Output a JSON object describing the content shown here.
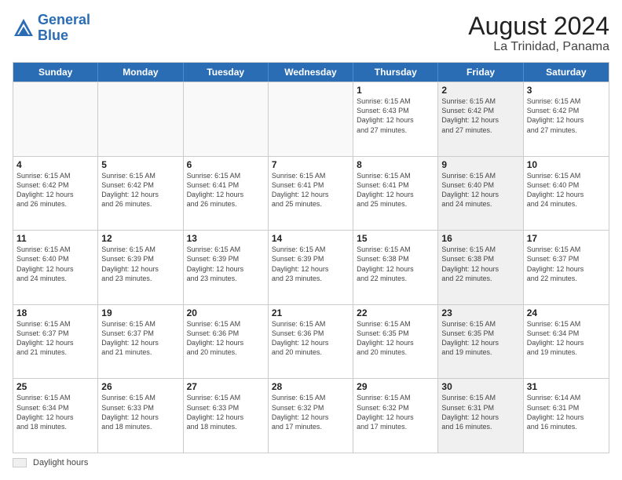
{
  "header": {
    "logo_general": "General",
    "logo_blue": "Blue",
    "title": "August 2024",
    "subtitle": "La Trinidad, Panama"
  },
  "days_of_week": [
    "Sunday",
    "Monday",
    "Tuesday",
    "Wednesday",
    "Thursday",
    "Friday",
    "Saturday"
  ],
  "footer": {
    "legend_label": "Daylight hours"
  },
  "weeks": [
    [
      {
        "day": "",
        "info": "",
        "shaded": false
      },
      {
        "day": "",
        "info": "",
        "shaded": false
      },
      {
        "day": "",
        "info": "",
        "shaded": false
      },
      {
        "day": "",
        "info": "",
        "shaded": false
      },
      {
        "day": "1",
        "info": "Sunrise: 6:15 AM\nSunset: 6:43 PM\nDaylight: 12 hours\nand 27 minutes.",
        "shaded": false
      },
      {
        "day": "2",
        "info": "Sunrise: 6:15 AM\nSunset: 6:42 PM\nDaylight: 12 hours\nand 27 minutes.",
        "shaded": true
      },
      {
        "day": "3",
        "info": "Sunrise: 6:15 AM\nSunset: 6:42 PM\nDaylight: 12 hours\nand 27 minutes.",
        "shaded": false
      }
    ],
    [
      {
        "day": "4",
        "info": "Sunrise: 6:15 AM\nSunset: 6:42 PM\nDaylight: 12 hours\nand 26 minutes.",
        "shaded": false
      },
      {
        "day": "5",
        "info": "Sunrise: 6:15 AM\nSunset: 6:42 PM\nDaylight: 12 hours\nand 26 minutes.",
        "shaded": false
      },
      {
        "day": "6",
        "info": "Sunrise: 6:15 AM\nSunset: 6:41 PM\nDaylight: 12 hours\nand 26 minutes.",
        "shaded": false
      },
      {
        "day": "7",
        "info": "Sunrise: 6:15 AM\nSunset: 6:41 PM\nDaylight: 12 hours\nand 25 minutes.",
        "shaded": false
      },
      {
        "day": "8",
        "info": "Sunrise: 6:15 AM\nSunset: 6:41 PM\nDaylight: 12 hours\nand 25 minutes.",
        "shaded": false
      },
      {
        "day": "9",
        "info": "Sunrise: 6:15 AM\nSunset: 6:40 PM\nDaylight: 12 hours\nand 24 minutes.",
        "shaded": true
      },
      {
        "day": "10",
        "info": "Sunrise: 6:15 AM\nSunset: 6:40 PM\nDaylight: 12 hours\nand 24 minutes.",
        "shaded": false
      }
    ],
    [
      {
        "day": "11",
        "info": "Sunrise: 6:15 AM\nSunset: 6:40 PM\nDaylight: 12 hours\nand 24 minutes.",
        "shaded": false
      },
      {
        "day": "12",
        "info": "Sunrise: 6:15 AM\nSunset: 6:39 PM\nDaylight: 12 hours\nand 23 minutes.",
        "shaded": false
      },
      {
        "day": "13",
        "info": "Sunrise: 6:15 AM\nSunset: 6:39 PM\nDaylight: 12 hours\nand 23 minutes.",
        "shaded": false
      },
      {
        "day": "14",
        "info": "Sunrise: 6:15 AM\nSunset: 6:39 PM\nDaylight: 12 hours\nand 23 minutes.",
        "shaded": false
      },
      {
        "day": "15",
        "info": "Sunrise: 6:15 AM\nSunset: 6:38 PM\nDaylight: 12 hours\nand 22 minutes.",
        "shaded": false
      },
      {
        "day": "16",
        "info": "Sunrise: 6:15 AM\nSunset: 6:38 PM\nDaylight: 12 hours\nand 22 minutes.",
        "shaded": true
      },
      {
        "day": "17",
        "info": "Sunrise: 6:15 AM\nSunset: 6:37 PM\nDaylight: 12 hours\nand 22 minutes.",
        "shaded": false
      }
    ],
    [
      {
        "day": "18",
        "info": "Sunrise: 6:15 AM\nSunset: 6:37 PM\nDaylight: 12 hours\nand 21 minutes.",
        "shaded": false
      },
      {
        "day": "19",
        "info": "Sunrise: 6:15 AM\nSunset: 6:37 PM\nDaylight: 12 hours\nand 21 minutes.",
        "shaded": false
      },
      {
        "day": "20",
        "info": "Sunrise: 6:15 AM\nSunset: 6:36 PM\nDaylight: 12 hours\nand 20 minutes.",
        "shaded": false
      },
      {
        "day": "21",
        "info": "Sunrise: 6:15 AM\nSunset: 6:36 PM\nDaylight: 12 hours\nand 20 minutes.",
        "shaded": false
      },
      {
        "day": "22",
        "info": "Sunrise: 6:15 AM\nSunset: 6:35 PM\nDaylight: 12 hours\nand 20 minutes.",
        "shaded": false
      },
      {
        "day": "23",
        "info": "Sunrise: 6:15 AM\nSunset: 6:35 PM\nDaylight: 12 hours\nand 19 minutes.",
        "shaded": true
      },
      {
        "day": "24",
        "info": "Sunrise: 6:15 AM\nSunset: 6:34 PM\nDaylight: 12 hours\nand 19 minutes.",
        "shaded": false
      }
    ],
    [
      {
        "day": "25",
        "info": "Sunrise: 6:15 AM\nSunset: 6:34 PM\nDaylight: 12 hours\nand 18 minutes.",
        "shaded": false
      },
      {
        "day": "26",
        "info": "Sunrise: 6:15 AM\nSunset: 6:33 PM\nDaylight: 12 hours\nand 18 minutes.",
        "shaded": false
      },
      {
        "day": "27",
        "info": "Sunrise: 6:15 AM\nSunset: 6:33 PM\nDaylight: 12 hours\nand 18 minutes.",
        "shaded": false
      },
      {
        "day": "28",
        "info": "Sunrise: 6:15 AM\nSunset: 6:32 PM\nDaylight: 12 hours\nand 17 minutes.",
        "shaded": false
      },
      {
        "day": "29",
        "info": "Sunrise: 6:15 AM\nSunset: 6:32 PM\nDaylight: 12 hours\nand 17 minutes.",
        "shaded": false
      },
      {
        "day": "30",
        "info": "Sunrise: 6:15 AM\nSunset: 6:31 PM\nDaylight: 12 hours\nand 16 minutes.",
        "shaded": true
      },
      {
        "day": "31",
        "info": "Sunrise: 6:14 AM\nSunset: 6:31 PM\nDaylight: 12 hours\nand 16 minutes.",
        "shaded": false
      }
    ]
  ]
}
